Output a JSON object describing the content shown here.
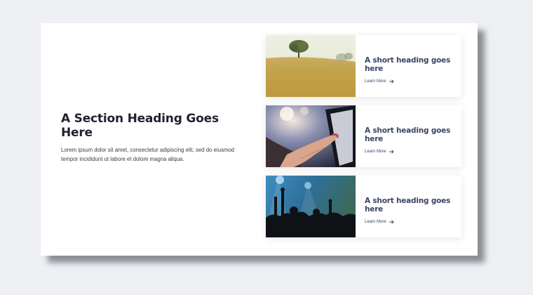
{
  "section": {
    "heading": "A Section Heading Goes Here",
    "body": "Lorem ipsum dolor sit amet, consectetur adipiscing elit, sed do eiusmod tempor incididunt ut labore et dolore magna aliqua."
  },
  "cards": [
    {
      "heading": "A short heading goes here",
      "link": "Learn More",
      "image": "field-tree-photo"
    },
    {
      "heading": "A short heading goes here",
      "link": "Learn More",
      "image": "tablet-touch-photo"
    },
    {
      "heading": "A short heading goes here",
      "link": "Learn More",
      "image": "concert-crowd-photo"
    }
  ],
  "icons": {
    "link_arrow": "arrow-right-icon"
  },
  "colors": {
    "heading": "#1f2230",
    "card_heading": "#3b4466",
    "background": "#eef0f4"
  }
}
